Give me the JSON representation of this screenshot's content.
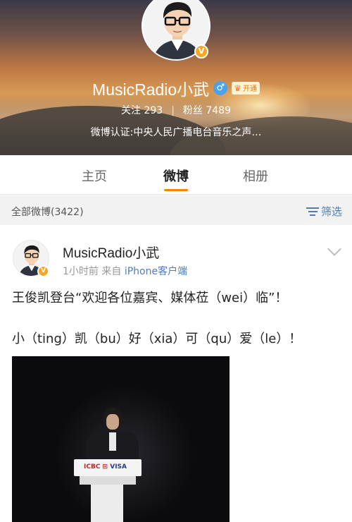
{
  "profile": {
    "name": "MusicRadio小武",
    "vip_label": "开通",
    "following_label": "关注",
    "following_count": "293",
    "separator": "|",
    "followers_label": "粉丝",
    "followers_count": "7489",
    "verification": "微博认证:中央人民广播电台音乐之声…",
    "gender_icon": "male-icon",
    "verified_icon": "verified-badge-icon"
  },
  "tabs": [
    {
      "label": "主页",
      "active": false
    },
    {
      "label": "微博",
      "active": true
    },
    {
      "label": "相册",
      "active": false
    }
  ],
  "filter_bar": {
    "all_posts_label": "全部微博(3422)",
    "filter_label": "筛选"
  },
  "post": {
    "author": "MusicRadio小武",
    "time": "1小时前",
    "source_prefix": "来自",
    "source": "iPhone客户端",
    "line1": "王俊凯登台“欢迎各位嘉宾、媒体莅（wei）临”！",
    "line2": "小（ting）凯（bu）好（xia）可（qu）爱（le）！",
    "photo_podium_text": {
      "icbc": "ICBC ⊞",
      "visa": "VISA"
    }
  },
  "colors": {
    "accent": "#ff8200",
    "link": "#507daf",
    "verified": "#f5a623",
    "gender": "#4aa3e8"
  }
}
